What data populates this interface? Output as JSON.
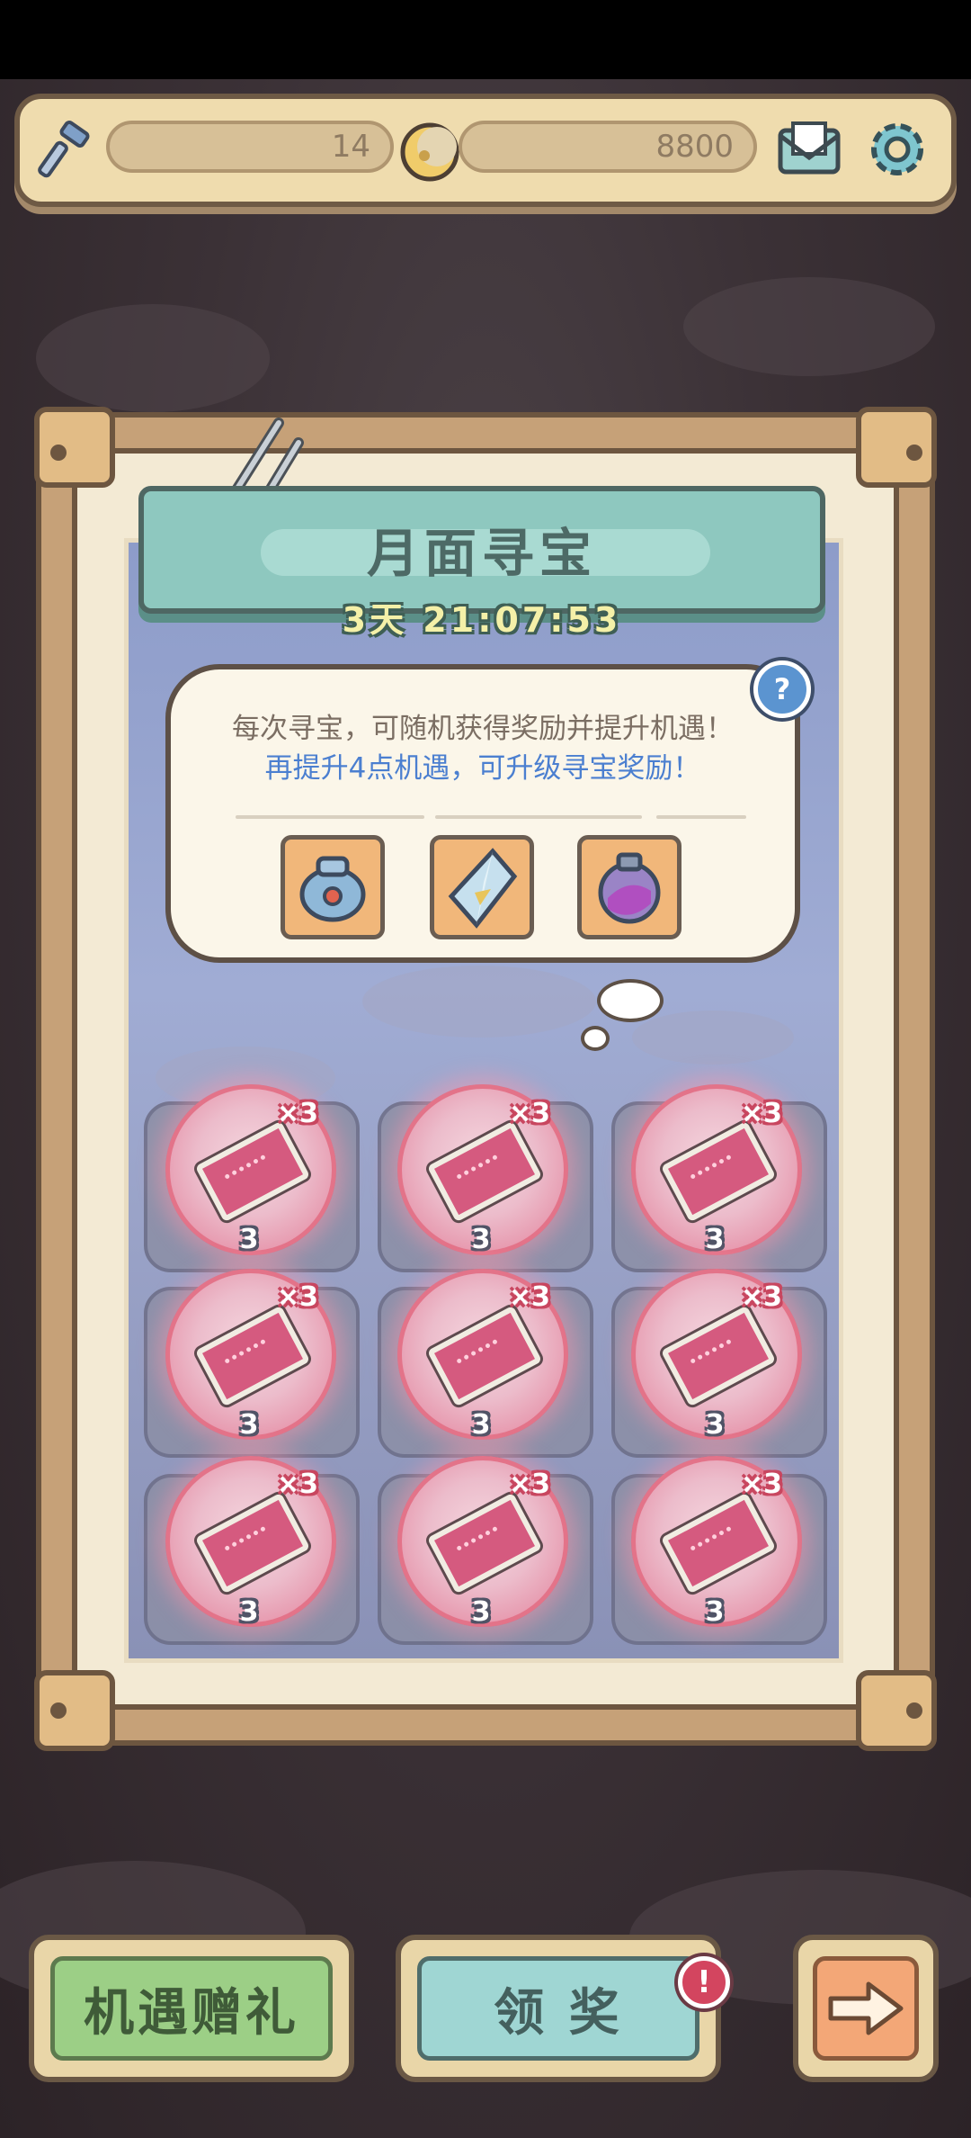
{
  "top_bar": {
    "energy_value": "14",
    "moon_currency_value": "8800",
    "icons": [
      "hammer-icon",
      "moon-coin-icon",
      "mail-icon",
      "gear-icon"
    ]
  },
  "event": {
    "title": "月面寻宝",
    "timer": "3天 21:07:53"
  },
  "info_bubble": {
    "line1": "每次寻宝，可随机获得奖励并提升机遇！",
    "line2": "再提升4点机遇，可升级寻宝奖励！",
    "help_label": "?",
    "rewards": [
      "treasure-pouch-icon",
      "crystal-icon",
      "purple-potion-icon"
    ]
  },
  "grid": {
    "items": [
      {
        "multiplier": "×3",
        "count": "3"
      },
      {
        "multiplier": "×3",
        "count": "3"
      },
      {
        "multiplier": "×3",
        "count": "3"
      },
      {
        "multiplier": "×3",
        "count": "3"
      },
      {
        "multiplier": "×3",
        "count": "3"
      },
      {
        "multiplier": "×3",
        "count": "3"
      },
      {
        "multiplier": "×3",
        "count": "3"
      },
      {
        "multiplier": "×3",
        "count": "3"
      },
      {
        "multiplier": "×3",
        "count": "3"
      }
    ]
  },
  "buttons": {
    "gift_label": "机遇赠礼",
    "claim_label": "领 奖",
    "claim_badge": "!"
  },
  "colors": {
    "accent_teal": "#8ec8bf",
    "gift_green": "#9ccf86",
    "claim_teal": "#9fd6d3",
    "next_orange": "#f3a777",
    "ticket_pink": "#d55a7f"
  }
}
